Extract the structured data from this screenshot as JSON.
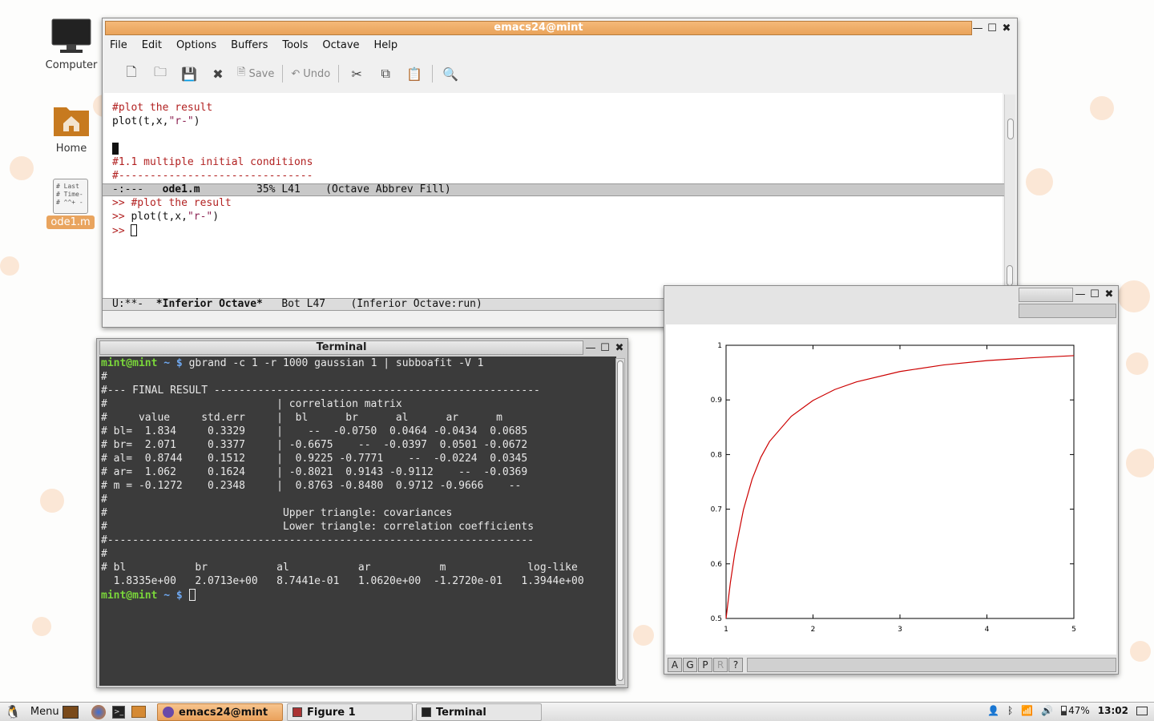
{
  "desktop": {
    "icons": [
      {
        "label": "Computer"
      },
      {
        "label": "Home"
      },
      {
        "label": "ode1.m"
      }
    ],
    "ode_thumb_lines": [
      "# Last",
      "# Time-",
      "# ^^+ -"
    ]
  },
  "emacs": {
    "title": "emacs24@mint",
    "menu": [
      "File",
      "Edit",
      "Options",
      "Buffers",
      "Tools",
      "Octave",
      "Help"
    ],
    "toolbar": {
      "save_label": "Save",
      "undo_label": "Undo"
    },
    "buffer_lines": [
      "#plot the result",
      "plot(t,x,",
      "\"r-\"",
      ")",
      "#1.1 multiple initial conditions",
      "#-------------------------------"
    ],
    "modeline1": {
      "status": "-:---",
      "name": "ode1.m",
      "pos": "35% L41",
      "mode": "(Octave Abbrev Fill)"
    },
    "repl_lines": [
      ">>",
      "#plot the result",
      "plot(t,x,",
      "\"r-\"",
      ")",
      ">>"
    ],
    "modeline2": {
      "status": "U:**-",
      "name": "*Inferior Octave*",
      "pos": "Bot L47",
      "mode": "(Inferior Octave:run)"
    }
  },
  "terminal": {
    "title": "Terminal",
    "prompt_user": "mint@mint",
    "prompt_path": "~ $",
    "command": "gbrand -c 1 -r 1000 gaussian 1 | subboafit -V 1",
    "lines": [
      "#",
      "#--- FINAL RESULT ----------------------------------------------------",
      "#                           | correlation matrix",
      "#     value     std.err     |  bl      br      al      ar      m",
      "# bl=  1.834     0.3329     |    --  -0.0750  0.0464 -0.0434  0.0685",
      "# br=  2.071     0.3377     | -0.6675    --  -0.0397  0.0501 -0.0672",
      "# al=  0.8744    0.1512     |  0.9225 -0.7771    --  -0.0224  0.0345",
      "# ar=  1.062     0.1624     | -0.8021  0.9143 -0.9112    --  -0.0369",
      "# m = -0.1272    0.2348     |  0.8763 -0.8480  0.9712 -0.9666    --",
      "#",
      "#                            Upper triangle: covariances",
      "#                            Lower triangle: correlation coefficients",
      "#--------------------------------------------------------------------",
      "#",
      "# bl           br           al           ar           m             log-like",
      "  1.8335e+00   2.0713e+00   8.7441e-01   1.0620e+00  -1.2720e-01   1.3944e+00"
    ]
  },
  "figure": {
    "toolbar_buttons": [
      "A",
      "G",
      "P",
      "R",
      "?"
    ]
  },
  "chart_data": {
    "type": "line",
    "x_ticks": [
      "1",
      "2",
      "3",
      "4",
      "5"
    ],
    "y_ticks": [
      "0.5",
      "0.6",
      "0.7",
      "0.8",
      "0.9",
      "1"
    ],
    "xlim": [
      1,
      5
    ],
    "ylim": [
      0.5,
      1
    ],
    "series": [
      {
        "color": "#cc0000",
        "x": [
          1,
          1.05,
          1.1,
          1.2,
          1.3,
          1.4,
          1.5,
          1.75,
          2,
          2.25,
          2.5,
          3,
          3.5,
          4,
          4.5,
          5
        ],
        "y": [
          0.5,
          0.566,
          0.619,
          0.699,
          0.755,
          0.795,
          0.824,
          0.87,
          0.899,
          0.919,
          0.933,
          0.952,
          0.964,
          0.972,
          0.977,
          0.981
        ]
      }
    ]
  },
  "taskbar": {
    "menu_label": "Menu",
    "windows": [
      "emacs24@mint",
      "Figure 1",
      "Terminal"
    ],
    "battery": "47%",
    "clock": "13:02"
  }
}
